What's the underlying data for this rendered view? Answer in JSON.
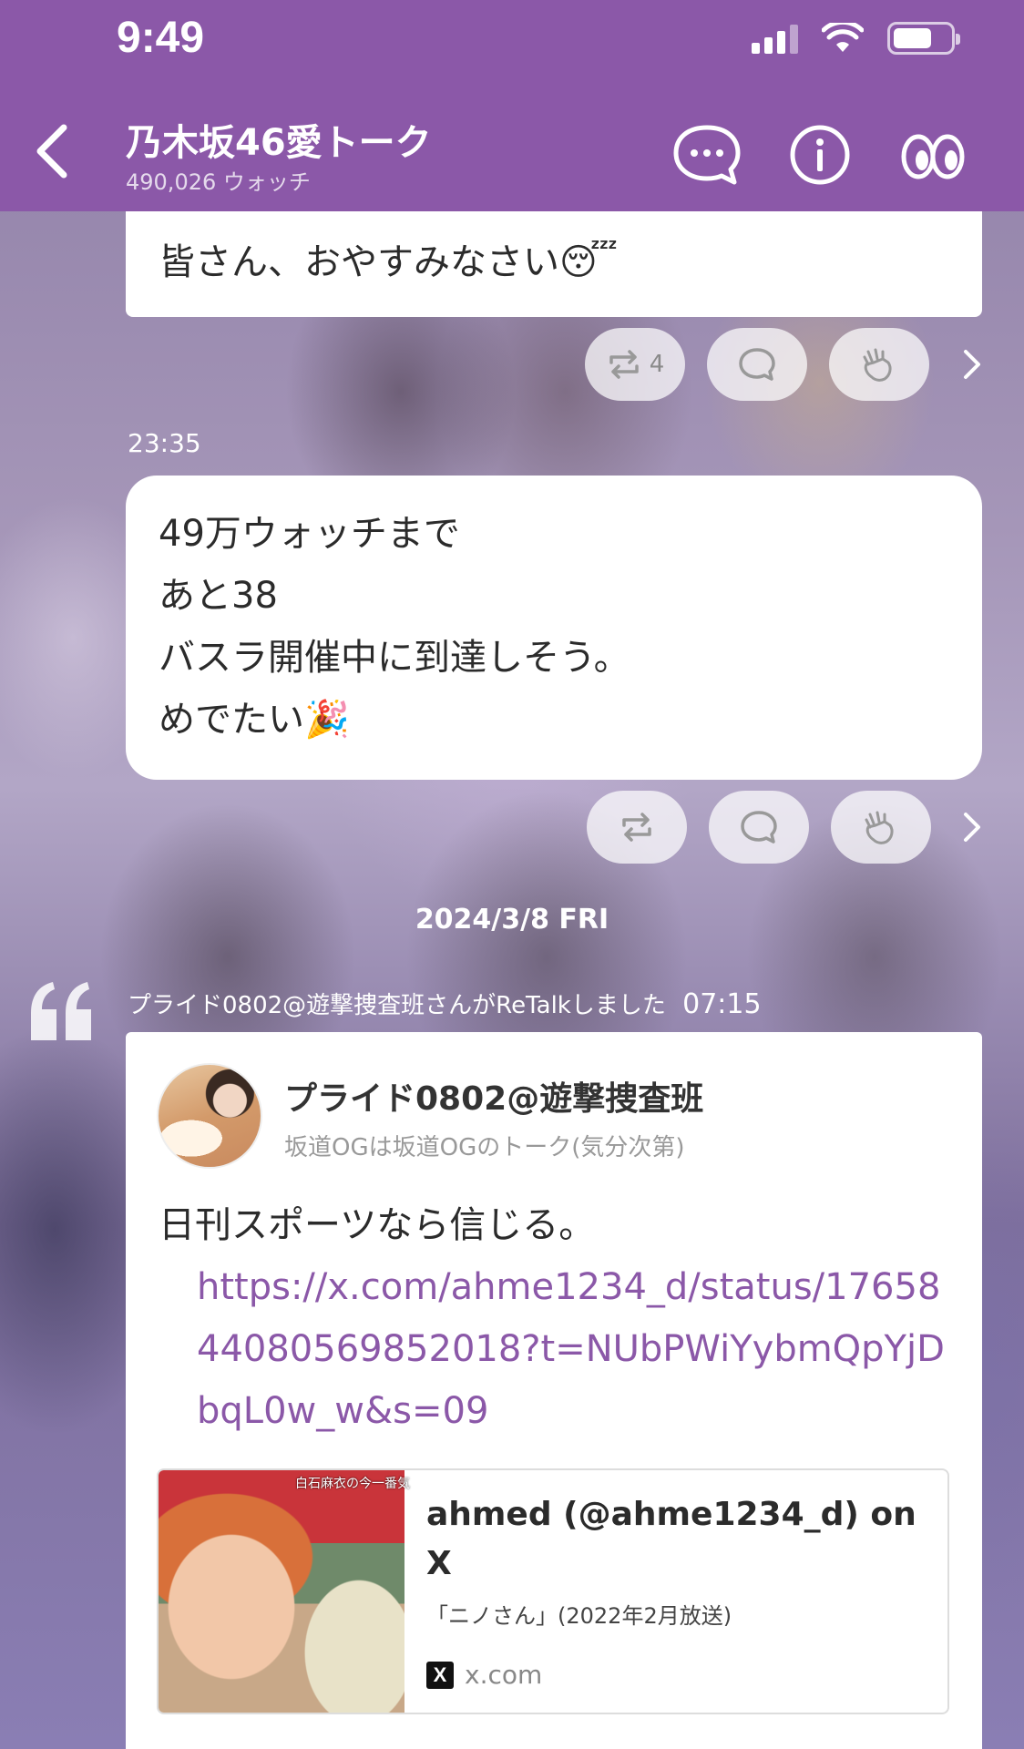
{
  "status_bar": {
    "time": "9:49"
  },
  "header": {
    "title": "乃木坂46愛トーク",
    "subtitle": "490,026 ウォッチ",
    "icons": [
      "back-arrow-icon",
      "chat-bubble-icon",
      "info-icon",
      "watch-eyes-icon"
    ]
  },
  "colors": {
    "header_bg": "#8b58a8",
    "link": "#8b58a8"
  },
  "messages": [
    {
      "text": "皆さん、おやすみなさい😴",
      "actions": {
        "retalk_count": "4"
      }
    },
    {
      "time": "23:35",
      "lines": [
        "49万ウォッチまで",
        "あと38",
        "バスラ開催中に到達しそう。",
        "めでたい🎉"
      ],
      "actions": {
        "retalk_count": ""
      }
    }
  ],
  "date_separator": "2024/3/8 FRI",
  "retalk": {
    "notice": "プライド0802@遊撃捜査班さんがReTalkしました",
    "time": "07:15",
    "user_name": "プライド0802@遊撃捜査班",
    "user_group": "坂道OGは坂道OGのトーク(気分次第)",
    "text": "日刊スポーツなら信じる。",
    "link": "https://x.com/ahme1234_d/status/1765844080569852018?t=NUbPWiYybmQpYjDbqL0w_w&s=09",
    "preview": {
      "thumb_caption": "白石麻衣の今一番気",
      "title": "ahmed (@ahme1234_d) on X",
      "description": "「ニノさん」(2022年2月放送)",
      "domain_icon": "X",
      "domain": "x.com"
    }
  }
}
